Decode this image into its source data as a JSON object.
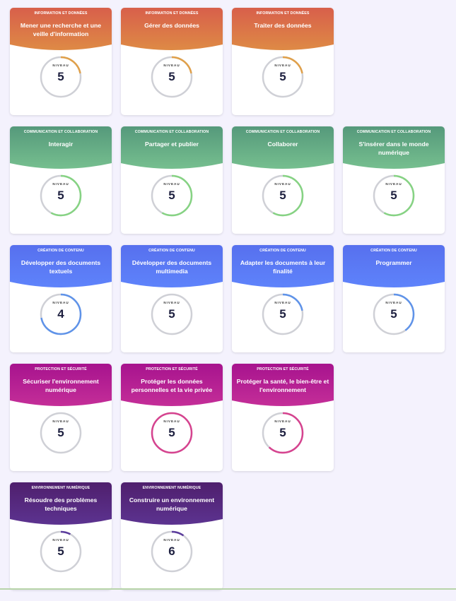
{
  "level_label": "NIVEAU",
  "categories": [
    {
      "name": "INFORMATION ET DONNÉES",
      "gradient": [
        "#d85f4b",
        "#de8a45"
      ],
      "ring_color": "#e0a04a",
      "cards": [
        {
          "title": "Mener une recherche et une veille d'information",
          "level": "5",
          "progress": 0.22
        },
        {
          "title": "Gérer des données",
          "level": "5",
          "progress": 0.22
        },
        {
          "title": "Traiter des données",
          "level": "5",
          "progress": 0.22
        }
      ]
    },
    {
      "name": "COMMUNICATION ET COLLABORATION",
      "gradient": [
        "#55997b",
        "#76bf8f"
      ],
      "ring_color": "#86d383",
      "cards": [
        {
          "title": "Interagir",
          "level": "5",
          "progress": 0.58
        },
        {
          "title": "Partager et publier",
          "level": "5",
          "progress": 0.58
        },
        {
          "title": "Collaborer",
          "level": "5",
          "progress": 0.58
        },
        {
          "title": "S'insérer dans le monde numérique",
          "level": "5",
          "progress": 0.58
        }
      ]
    },
    {
      "name": "CRÉATION DE CONTENU",
      "gradient": [
        "#5770ee",
        "#5e83fb"
      ],
      "ring_color": "#5f93e9",
      "cards": [
        {
          "title": "Développer des documents textuels",
          "level": "4",
          "progress": 0.72
        },
        {
          "title": "Développer des documents multimedia",
          "level": "5",
          "progress": 0.0
        },
        {
          "title": "Adapter les documents à leur finalité",
          "level": "5",
          "progress": 0.22
        },
        {
          "title": "Programmer",
          "level": "5",
          "progress": 0.4
        }
      ]
    },
    {
      "name": "PROTECTION ET SÉCURITÉ",
      "gradient": [
        "#a7138e",
        "#c42e98"
      ],
      "ring_color": "#d6438f",
      "cards": [
        {
          "title": "Sécuriser l'environnement numérique",
          "level": "5",
          "progress": 0.0
        },
        {
          "title": "Protéger les données personnelles et la vie privée",
          "level": "5",
          "progress": 1.0
        },
        {
          "title": "Protéger la santé, le bien-être et l'environnement",
          "level": "5",
          "progress": 0.62
        }
      ]
    },
    {
      "name": "ENVIRONNEMENT NUMÉRIQUE",
      "gradient": [
        "#4f1f6d",
        "#5c3390"
      ],
      "ring_color": "#5b3c9c",
      "cards": [
        {
          "title": "Résoudre des problèmes techniques",
          "level": "5",
          "progress": 0.08
        },
        {
          "title": "Construire un environnement numérique",
          "level": "6",
          "progress": 0.1
        }
      ]
    }
  ]
}
